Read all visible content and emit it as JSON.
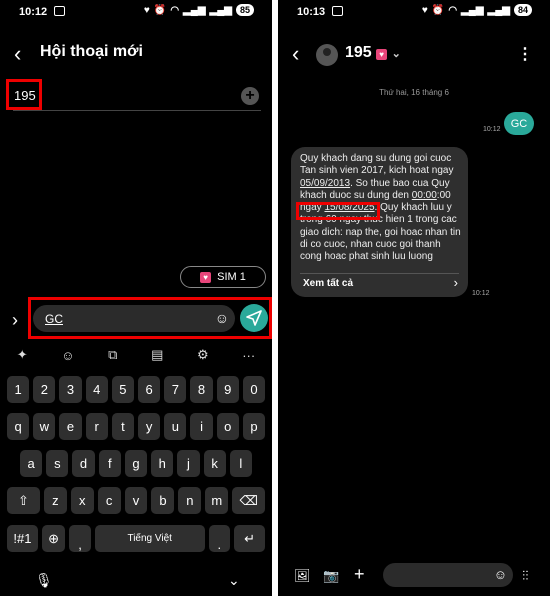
{
  "left": {
    "status": {
      "time": "10:12",
      "battery": "85"
    },
    "title": "Hội thoại mới",
    "recipient": "195",
    "sim_button": "SIM 1",
    "composer_text": "GC",
    "keyboard": {
      "row1": [
        "1",
        "2",
        "3",
        "4",
        "5",
        "6",
        "7",
        "8",
        "9",
        "0"
      ],
      "row2": [
        "q",
        "w",
        "e",
        "r",
        "t",
        "y",
        "u",
        "i",
        "o",
        "p"
      ],
      "row3": [
        "a",
        "s",
        "d",
        "f",
        "g",
        "h",
        "j",
        "k",
        "l"
      ],
      "row4": [
        "⇧",
        "z",
        "x",
        "c",
        "v",
        "b",
        "n",
        "m",
        "⌫"
      ],
      "row5": [
        "!#1",
        "⊕",
        ",",
        "Tiếng Việt",
        ".",
        "↵"
      ]
    }
  },
  "right": {
    "status": {
      "time": "10:13",
      "battery": "84"
    },
    "title": "195",
    "date_divider": "Thứ hai, 16 tháng 6",
    "sent": {
      "text": "GC",
      "time": "10:12"
    },
    "received": {
      "part1": "Quy khach dang su dung goi cuoc Tan sinh vien 2017, kich hoat ngay ",
      "date1": "05/09/2013",
      "part2": ". So thue bao cua Quy khach duoc su dung den ",
      "time1": "00:00",
      "part3": ":00 ngay ",
      "date2": "15/08/2025",
      "part4": ". Quy khach luu y trong 60 ngay thuc hien 1 trong cac giao dich: nap the, goi hoac nhan tin di co cuoc, nhan cuoc goi thanh cong hoac phat sinh luu luong",
      "see_all": "Xem tất cả",
      "time": "10:12"
    }
  }
}
